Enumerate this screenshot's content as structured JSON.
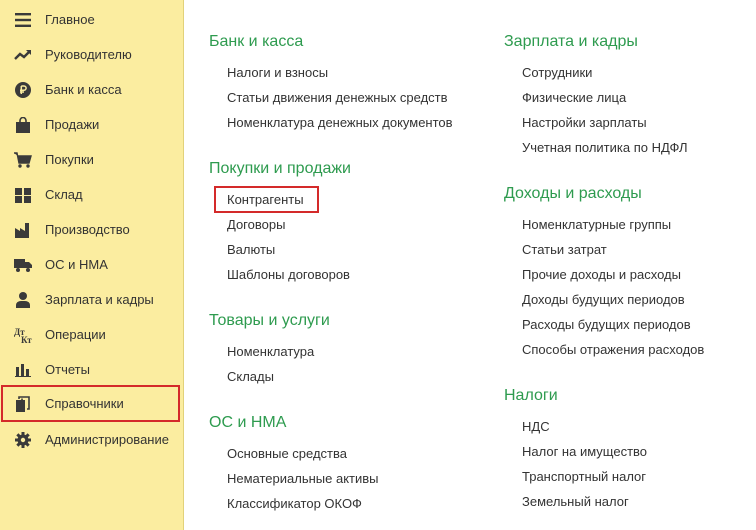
{
  "sidebar": {
    "items": [
      {
        "label": "Главное",
        "icon": "menu-icon"
      },
      {
        "label": "Руководителю",
        "icon": "trend-icon"
      },
      {
        "label": "Банк и касса",
        "icon": "ruble-icon"
      },
      {
        "label": "Продажи",
        "icon": "shopping-bag-icon"
      },
      {
        "label": "Покупки",
        "icon": "cart-icon"
      },
      {
        "label": "Склад",
        "icon": "warehouse-icon"
      },
      {
        "label": "Производство",
        "icon": "factory-icon"
      },
      {
        "label": "ОС и НМА",
        "icon": "truck-icon"
      },
      {
        "label": "Зарплата и кадры",
        "icon": "person-icon"
      },
      {
        "label": "Операции",
        "icon": "dt-kt-icon"
      },
      {
        "label": "Отчеты",
        "icon": "bar-chart-icon"
      },
      {
        "label": "Справочники",
        "icon": "reference-books-icon"
      },
      {
        "label": "Администрирование",
        "icon": "gear-icon"
      }
    ],
    "selected": "Справочники",
    "highlight_color": "#d42a2a",
    "background": "#fbeda0"
  },
  "content": {
    "title_color": "#2e9b4f",
    "left_column": [
      {
        "title": "Банк и касса",
        "links": [
          "Налоги и взносы",
          "Статьи движения денежных средств",
          "Номенклатура денежных документов"
        ]
      },
      {
        "title": "Покупки и продажи",
        "links": [
          "Контрагенты",
          "Договоры",
          "Валюты",
          "Шаблоны договоров"
        ]
      },
      {
        "title": "Товары и услуги",
        "links": [
          "Номенклатура",
          "Склады"
        ]
      },
      {
        "title": "ОС и НМА",
        "links": [
          "Основные средства",
          "Нематериальные активы",
          "Классификатор ОКОФ"
        ]
      }
    ],
    "right_column": [
      {
        "title": "Зарплата и кадры",
        "links": [
          "Сотрудники",
          "Физические лица",
          "Настройки зарплаты",
          "Учетная политика по НДФЛ"
        ]
      },
      {
        "title": "Доходы и расходы",
        "links": [
          "Номенклатурные группы",
          "Статьи затрат",
          "Прочие доходы и расходы",
          "Доходы будущих периодов",
          "Расходы будущих периодов",
          "Способы отражения расходов"
        ]
      },
      {
        "title": "Налоги",
        "links": [
          "НДС",
          "Налог на имущество",
          "Транспортный налог",
          "Земельный налог"
        ]
      }
    ],
    "highlighted_link": "Контрагенты"
  }
}
